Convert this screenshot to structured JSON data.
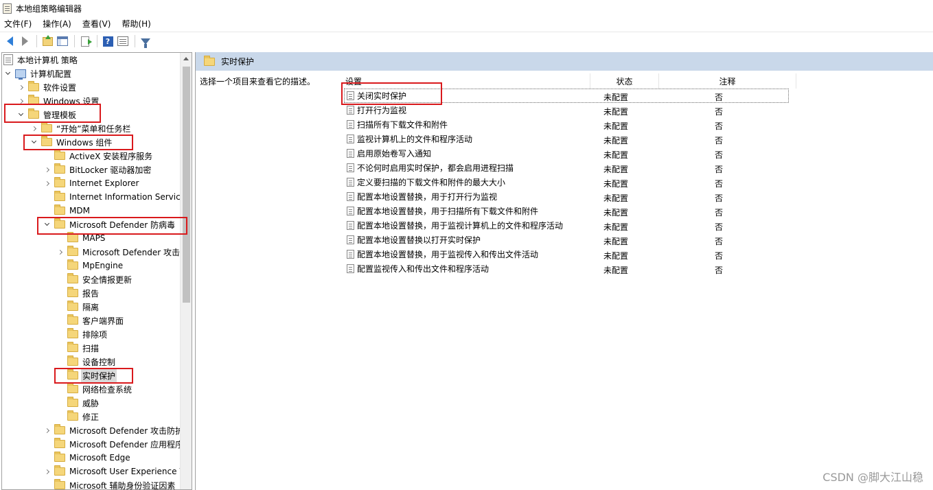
{
  "window": {
    "title": "本地组策略编辑器"
  },
  "menu": [
    "文件(F)",
    "操作(A)",
    "查看(V)",
    "帮助(H)"
  ],
  "toolbar": {
    "buttons": [
      "back-icon",
      "forward-icon",
      "up-folder-icon",
      "show-hide-tree-icon",
      "export-list-icon",
      "help-icon",
      "properties-icon",
      "filter-icon"
    ]
  },
  "tree": {
    "items": [
      {
        "label": "本地计算机 策略"
      },
      {
        "label": "计算机配置"
      },
      {
        "label": "软件设置"
      },
      {
        "label": "Windows 设置"
      },
      {
        "label": "管理模板"
      },
      {
        "label": "“开始”菜单和任务栏"
      },
      {
        "label": "Windows 组件"
      },
      {
        "label": "ActiveX 安装程序服务"
      },
      {
        "label": "BitLocker 驱动器加密"
      },
      {
        "label": "Internet Explorer"
      },
      {
        "label": "Internet Information Service"
      },
      {
        "label": "MDM"
      },
      {
        "label": "Microsoft Defender 防病毒"
      },
      {
        "label": "MAPS"
      },
      {
        "label": "Microsoft Defender 攻击"
      },
      {
        "label": "MpEngine"
      },
      {
        "label": "安全情报更新"
      },
      {
        "label": "报告"
      },
      {
        "label": "隔离"
      },
      {
        "label": "客户端界面"
      },
      {
        "label": "排除项"
      },
      {
        "label": "扫描"
      },
      {
        "label": "设备控制"
      },
      {
        "label": "实时保护"
      },
      {
        "label": "网络检查系统"
      },
      {
        "label": "威胁"
      },
      {
        "label": "修正"
      },
      {
        "label": "Microsoft Defender 攻击防护"
      },
      {
        "label": "Microsoft Defender 应用程序"
      },
      {
        "label": "Microsoft Edge"
      },
      {
        "label": "Microsoft User Experience V"
      },
      {
        "label": "Microsoft 辅助身份验证因素"
      }
    ]
  },
  "right": {
    "header_title": "实时保护",
    "description": "选择一个项目来查看它的描述。",
    "columns": {
      "setting": "设置",
      "state": "状态",
      "comment": "注释"
    },
    "rows": [
      {
        "setting": "关闭实时保护",
        "state": "未配置",
        "comment": "否"
      },
      {
        "setting": "打开行为监视",
        "state": "未配置",
        "comment": "否"
      },
      {
        "setting": "扫描所有下载文件和附件",
        "state": "未配置",
        "comment": "否"
      },
      {
        "setting": "监视计算机上的文件和程序活动",
        "state": "未配置",
        "comment": "否"
      },
      {
        "setting": "启用原始卷写入通知",
        "state": "未配置",
        "comment": "否"
      },
      {
        "setting": "不论何时启用实时保护，都会启用进程扫描",
        "state": "未配置",
        "comment": "否"
      },
      {
        "setting": "定义要扫描的下载文件和附件的最大大小",
        "state": "未配置",
        "comment": "否"
      },
      {
        "setting": "配置本地设置替换，用于打开行为监视",
        "state": "未配置",
        "comment": "否"
      },
      {
        "setting": "配置本地设置替换，用于扫描所有下载文件和附件",
        "state": "未配置",
        "comment": "否"
      },
      {
        "setting": "配置本地设置替换，用于监视计算机上的文件和程序活动",
        "state": "未配置",
        "comment": "否"
      },
      {
        "setting": "配置本地设置替换以打开实时保护",
        "state": "未配置",
        "comment": "否"
      },
      {
        "setting": "配置本地设置替换，用于监视传入和传出文件活动",
        "state": "未配置",
        "comment": "否"
      },
      {
        "setting": "配置监视传入和传出文件和程序活动",
        "state": "未配置",
        "comment": "否"
      }
    ]
  },
  "watermark": "CSDN @脚大江山稳",
  "colors": {
    "header_bg": "#c9d8ea",
    "highlight_box": "#d9191c",
    "folder": "#f5d67a"
  }
}
